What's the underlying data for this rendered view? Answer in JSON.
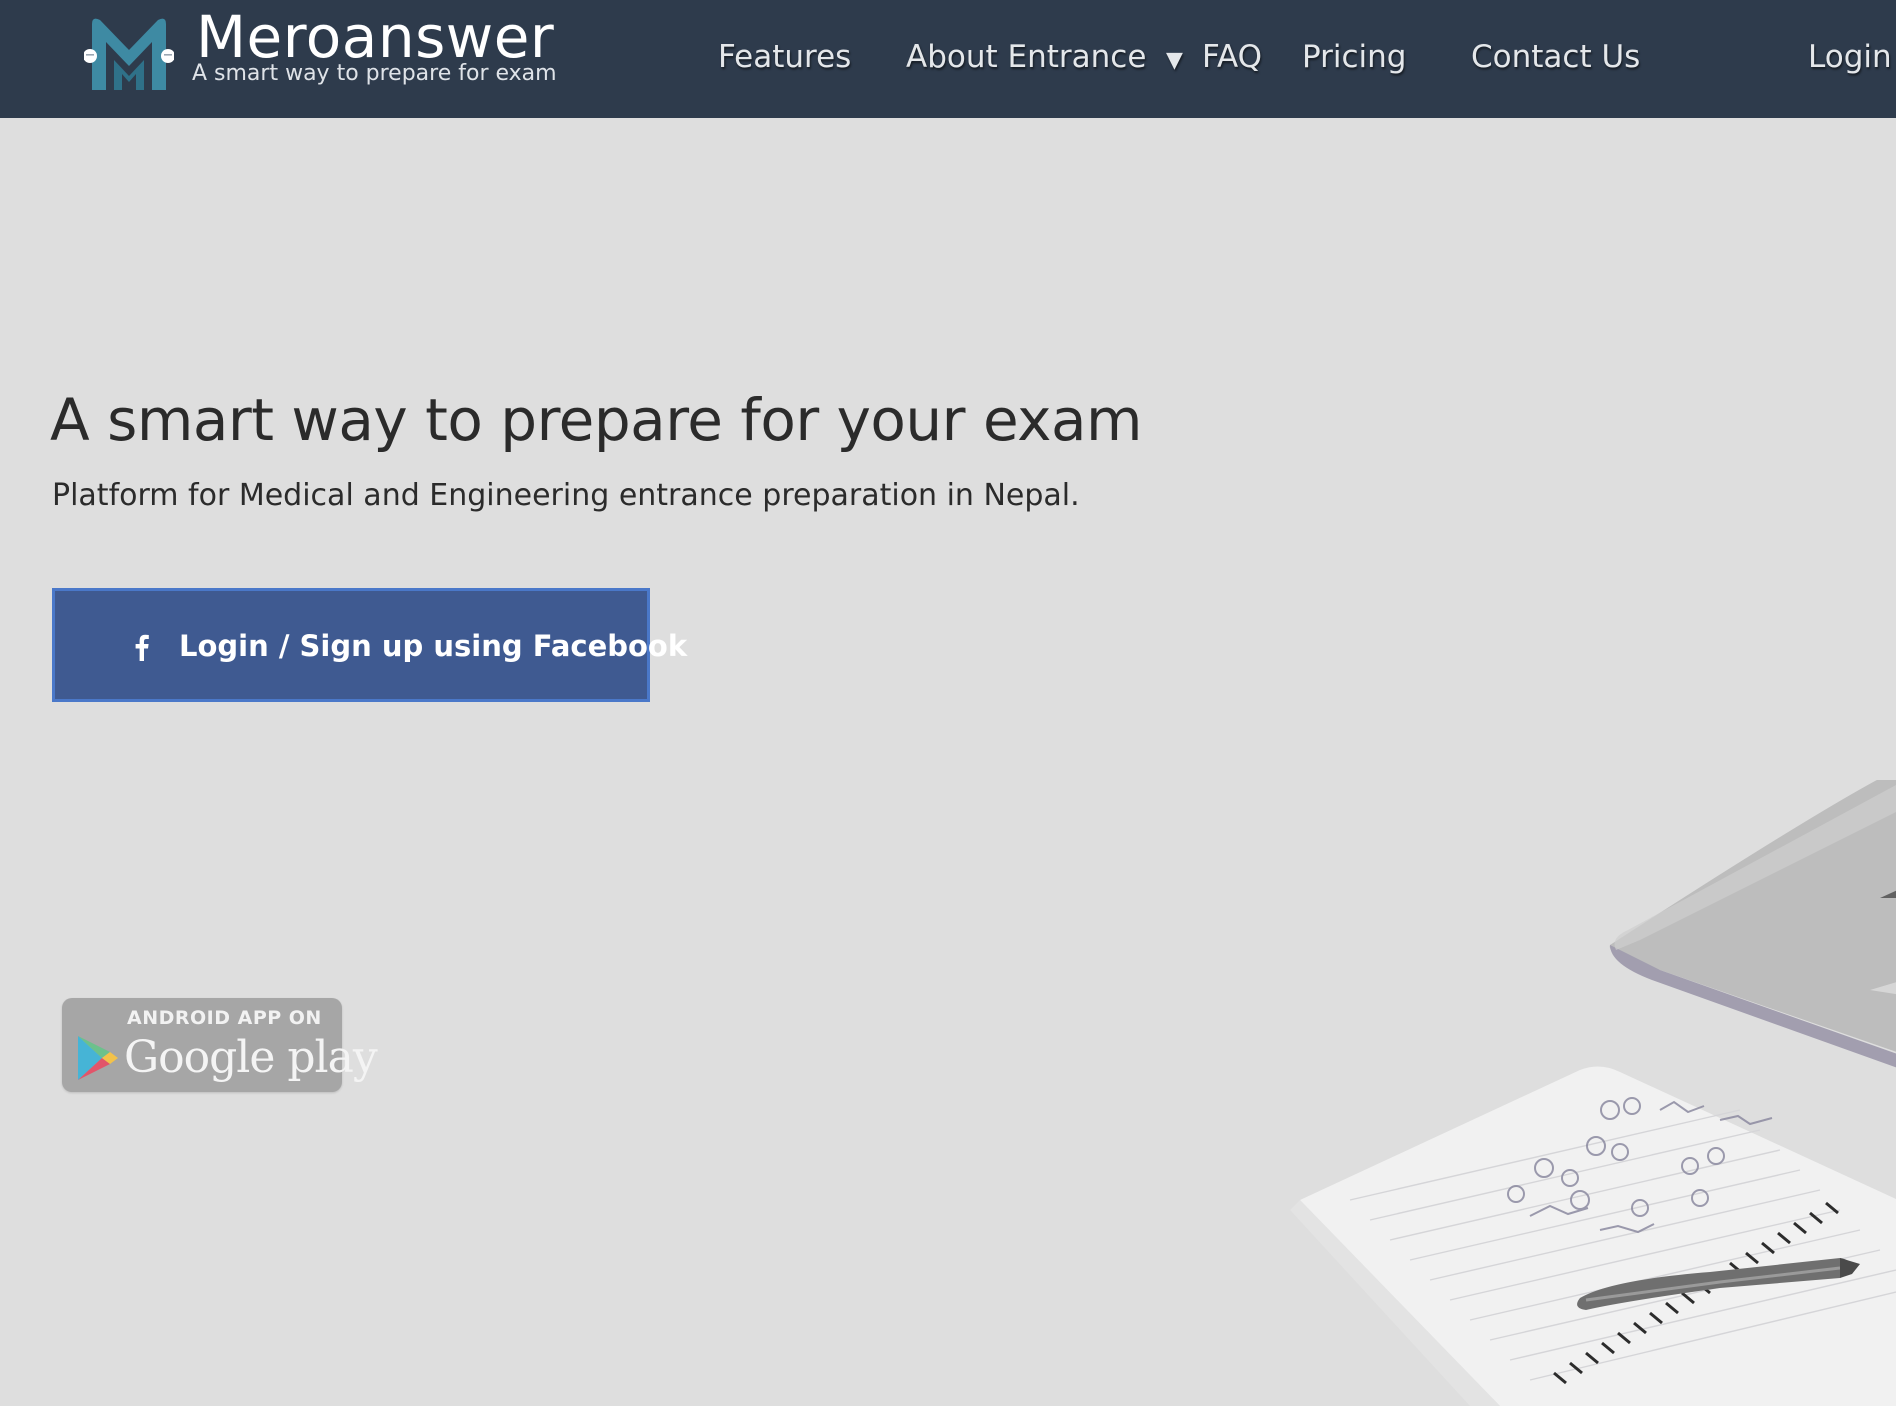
{
  "brand": {
    "name": "Meroanswer",
    "tagline": "A smart way to prepare for exam",
    "logo_icon": "m-logo-icon"
  },
  "nav": {
    "features": "Features",
    "about_entrance": "About Entrance",
    "about_dropdown_icon": "caret-down-icon",
    "faq": "FAQ",
    "pricing": "Pricing",
    "contact_us": "Contact Us",
    "login": "Login"
  },
  "hero": {
    "title": "A smart way to prepare for your exam",
    "subtitle": "Platform for Medical and Engineering entrance preparation in Nepal.",
    "cta_label": "Login / Sign up using Facebook",
    "cta_icon": "facebook-icon"
  },
  "app_badge": {
    "top_text": "ANDROID APP ON",
    "bottom_text": "Google play",
    "icon": "google-play-icon"
  },
  "colors": {
    "navbar_bg": "#2e3b4c",
    "page_bg": "#dedede",
    "facebook_blue": "#3f5a91",
    "badge_bg": "#a6a6a6",
    "logo_teal": "#3e8aa3"
  }
}
